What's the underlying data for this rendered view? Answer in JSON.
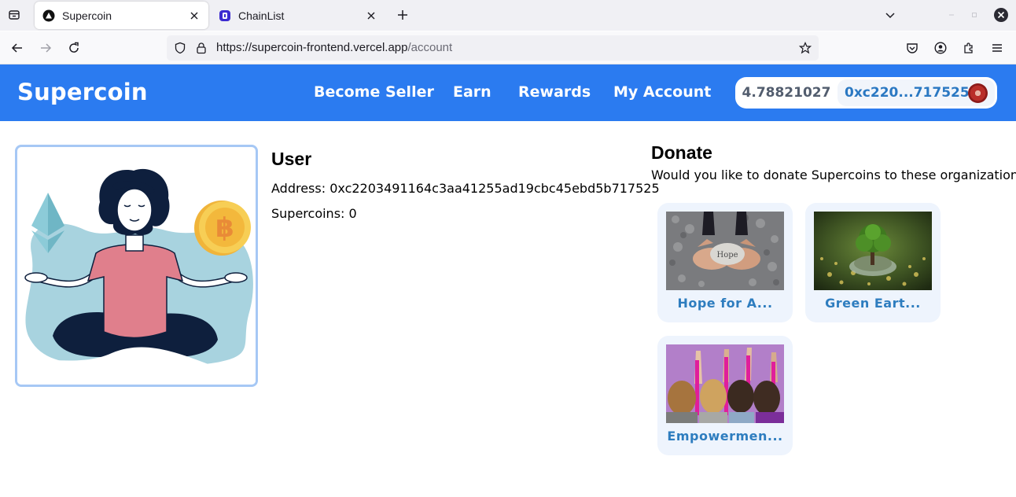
{
  "browser": {
    "tabs": [
      {
        "title": "Supercoin",
        "active": true
      },
      {
        "title": "ChainList",
        "active": false
      }
    ],
    "url": {
      "host": "https://supercoin-frontend.vercel.app",
      "path": "/account"
    }
  },
  "header": {
    "brand": "Supercoin",
    "nav": [
      "Become Seller",
      "Earn",
      "Rewards",
      "My Account"
    ],
    "wallet": {
      "balance": "4.78821027",
      "address": "0xc220...717525"
    }
  },
  "user": {
    "heading": "User",
    "address_label": "Address:",
    "address": "0xc2203491164c3aa41255ad19cbc45ebd5b717525",
    "supercoins_label": "Supercoins:",
    "supercoins": "0"
  },
  "donate": {
    "heading": "Donate",
    "subtitle": "Would you like to donate Supercoins to these organizations",
    "image_caption": "Hope",
    "organizations": [
      {
        "name": "Hope for A..."
      },
      {
        "name": "Green Eart..."
      },
      {
        "name": "Empowermen..."
      }
    ]
  },
  "colors": {
    "header_bg": "#2b7bf0",
    "card_bg": "#eef4fd",
    "org_name": "#2e7dbf",
    "profile_border": "#a6c8f5"
  },
  "icons": [
    "tab-list-icon",
    "supercoin-favicon",
    "chainlist-favicon",
    "close-icon",
    "plus-icon",
    "chevron-down-icon",
    "minimize-icon",
    "maximize-icon",
    "window-close-icon",
    "back-icon",
    "forward-icon",
    "reload-icon",
    "shield-icon",
    "lock-icon",
    "star-icon",
    "pocket-icon",
    "account-icon",
    "extensions-icon",
    "menu-icon"
  ]
}
